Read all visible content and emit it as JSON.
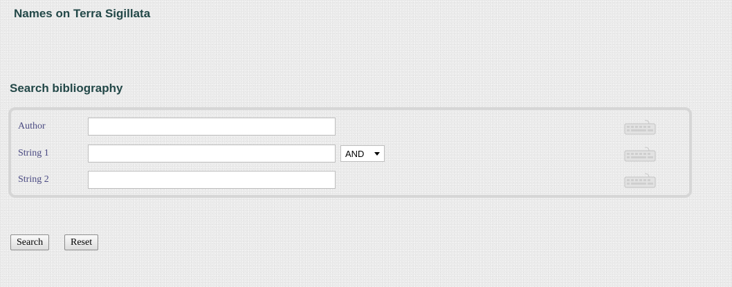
{
  "page": {
    "site_title": "Names on Terra Sigillata",
    "section_heading": "Search bibliography"
  },
  "form": {
    "fields": [
      {
        "label": "Author",
        "value": "",
        "keyboard_icon": "virtual-keyboard-icon"
      },
      {
        "label": "String 1",
        "value": "",
        "keyboard_icon": "virtual-keyboard-icon"
      },
      {
        "label": "String 2",
        "value": "",
        "keyboard_icon": "virtual-keyboard-icon"
      }
    ],
    "operator": {
      "selected": "AND"
    }
  },
  "buttons": {
    "search_label": "Search",
    "reset_label": "Reset"
  },
  "colors": {
    "heading": "#234848",
    "label": "#4a4a82",
    "box_border": "#d6d6d6",
    "background": "#ececec"
  }
}
